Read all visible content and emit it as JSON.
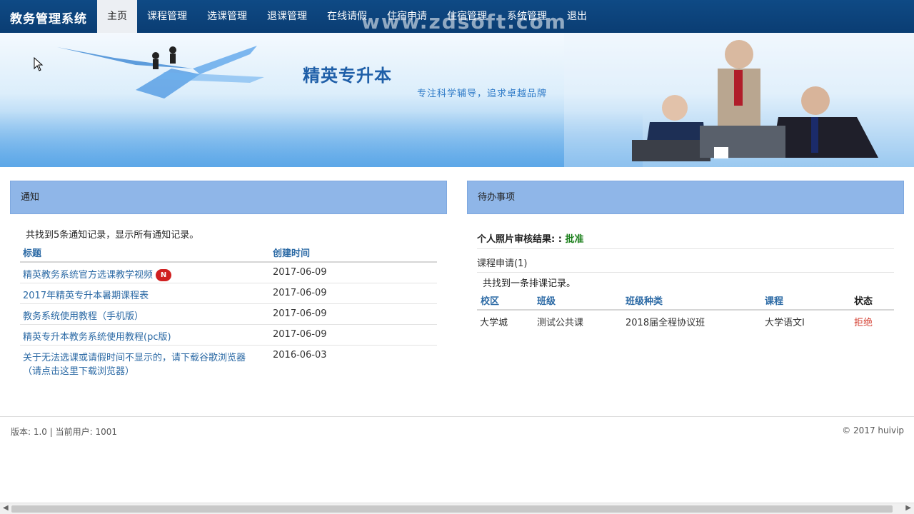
{
  "app": {
    "title": "教务管理系统",
    "watermark": "www.zdsoft.com"
  },
  "nav": [
    "主页",
    "课程管理",
    "选课管理",
    "退课管理",
    "在线请假",
    "住宿申请",
    "住宿管理",
    "系统管理",
    "退出"
  ],
  "banner": {
    "title": "精英专升本",
    "slogan": "专注科学辅导，追求卓越品牌"
  },
  "notice": {
    "header": "通知",
    "found_text": "共找到5条通知记录，显示所有通知记录。",
    "columns": [
      "标题",
      "创建时间"
    ],
    "rows": [
      {
        "title": "精英教务系统官方选课教学视频",
        "badge": "N",
        "date": "2017-06-09"
      },
      {
        "title": "2017年精英专升本暑期课程表",
        "date": "2017-06-09"
      },
      {
        "title": "教务系统使用教程（手机版）",
        "date": "2017-06-09"
      },
      {
        "title": "精英专升本教务系统使用教程(pc版)",
        "date": "2017-06-09"
      },
      {
        "title_line1": "关于无法选课或请假时间不显示的，请下载谷歌浏览器",
        "title_line2": "（请点击这里下载浏览器）",
        "date": "2016-06-03"
      }
    ]
  },
  "todo": {
    "header": "待办事项",
    "photo_label": "个人照片审核结果: :",
    "photo_status": "批准",
    "course_apply": "课程申请(1)",
    "found_text": "共找到一条排课记录。",
    "columns": [
      "校区",
      "班级",
      "班级种类",
      "课程",
      "状态"
    ],
    "row": {
      "campus": "大学城",
      "class": "测试公共课",
      "class_type": "2018届全程协议班",
      "course": "大学语文Ⅰ",
      "status": "拒绝"
    }
  },
  "footer": {
    "left": "版本:  1.0 | 当前用户: 1001",
    "right": "© 2017 huivip"
  },
  "colors": {
    "nav_bg": "#0f4a85",
    "panel_head": "#8fb6e8",
    "link": "#2c6aa5",
    "approve": "#1a7f1a",
    "reject": "#d33a2c"
  }
}
